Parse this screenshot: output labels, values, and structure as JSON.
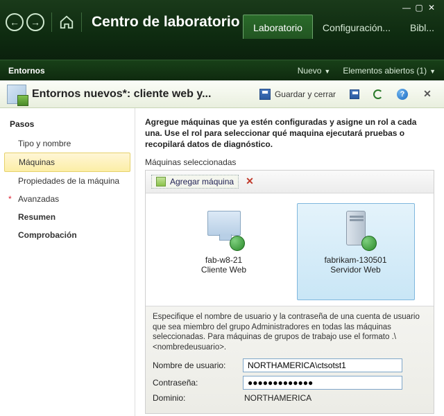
{
  "breadcrumb": "Centro de laboratorio",
  "tabs": {
    "lab": "Laboratorio",
    "config": "Configuración...",
    "bibl": "Bibl..."
  },
  "subbar": {
    "left": "Entornos",
    "nuevo": "Nuevo",
    "abiertos": "Elementos abiertos (1)"
  },
  "doc": {
    "title": "Entornos nuevos*: cliente web y...",
    "save_close": "Guardar y cerrar"
  },
  "sidebar": {
    "head": "Pasos",
    "items": [
      "Tipo y nombre",
      "Máquinas",
      "Propiedades de la máquina",
      "Avanzadas",
      "Resumen",
      "Comprobación"
    ]
  },
  "instr": "Agregue máquinas que ya estén configuradas y asigne un rol a cada una. Use el rol para seleccionar qué maquina ejecutará pruebas o recopilará datos de diagnóstico.",
  "sec_label": "Máquinas seleccionadas",
  "add_btn": "Agregar máquina",
  "machines": [
    {
      "name": "fab-w8-21",
      "role": "Cliente Web"
    },
    {
      "name": "fabrikam-130501",
      "role": "Servidor Web"
    }
  ],
  "cred": {
    "instr": "Especifique el nombre de usuario y la contraseña de una cuenta de usuario que sea miembro del grupo Administradores en todas las máquinas seleccionadas. Para máquinas de grupos de trabajo use el formato .\\<nombredeusuario>.",
    "user_label": "Nombre de usuario:",
    "user_value": "NORTHAMERICA\\ctsotst1",
    "pass_label": "Contraseña:",
    "pass_value": "●●●●●●●●●●●●●",
    "domain_label": "Dominio:",
    "domain_value": "NORTHAMERICA"
  }
}
